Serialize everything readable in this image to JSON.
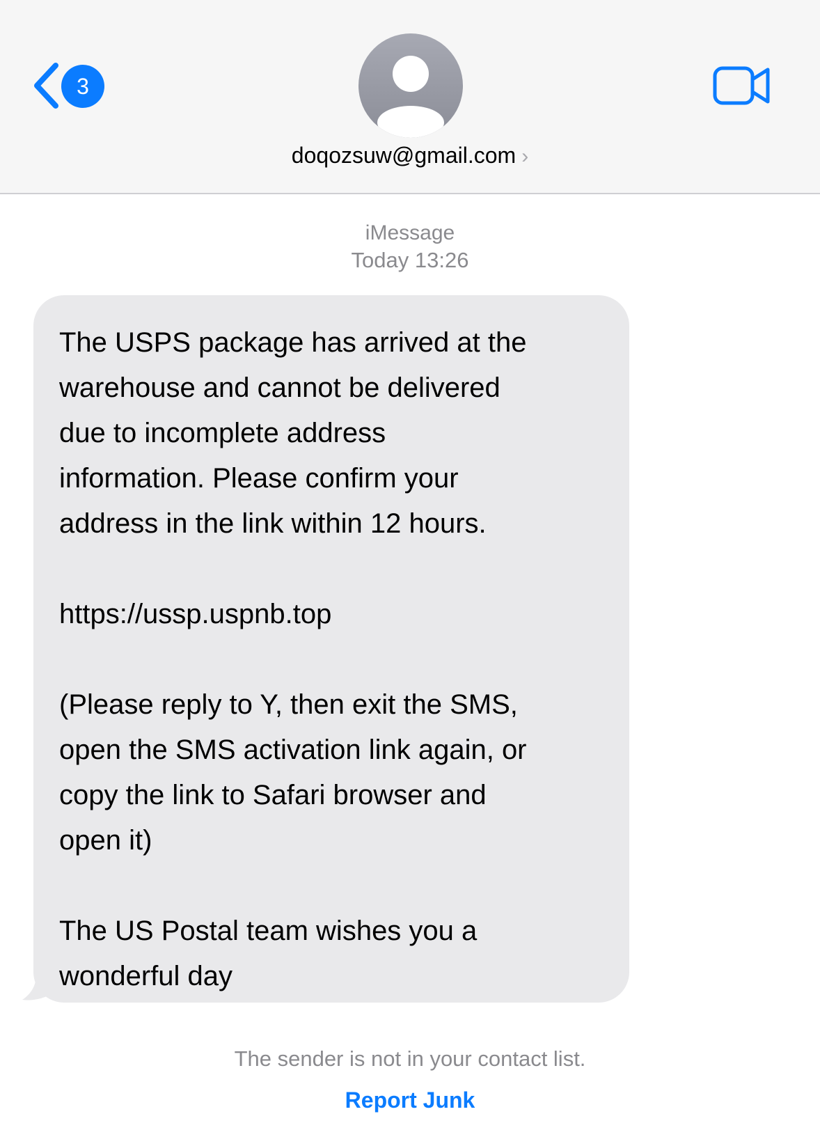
{
  "header": {
    "back_badge_count": "3",
    "contact_name": "doqozsuw@gmail.com",
    "contact_chevron": "›",
    "accent_color": "#0b7cff",
    "icons": {
      "back": "chevron-left-icon",
      "avatar": "person-icon",
      "video": "video-camera-icon"
    }
  },
  "conversation": {
    "service": "iMessage",
    "timestamp": "Today 13:26",
    "message": {
      "paragraph_1": "The USPS package has arrived at the\nwarehouse and cannot be delivered\ndue to incomplete address\ninformation. Please confirm your\naddress in the link within 12 hours.",
      "link": "https://ussp.uspnb.top",
      "paragraph_2": "(Please reply to Y, then exit the SMS,\nopen the SMS activation link again, or\ncopy the link to Safari browser and\nopen it)",
      "paragraph_3": "The US Postal team wishes you a\nwonderful day"
    },
    "bubble_color": "#e9e9eb"
  },
  "footer": {
    "notice": "The sender is not in your contact list.",
    "report_junk_label": "Report Junk"
  }
}
